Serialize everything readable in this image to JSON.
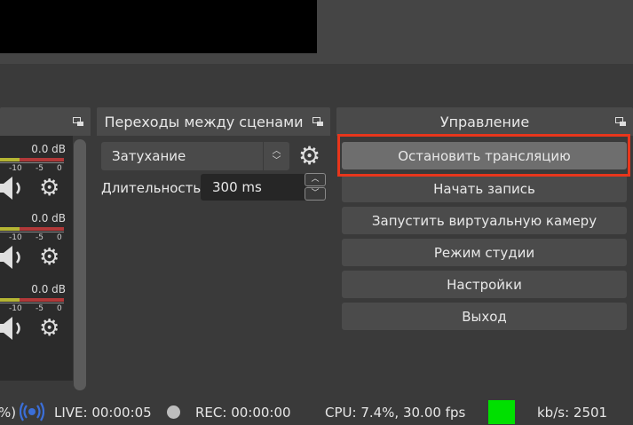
{
  "mixer": {
    "channels": [
      {
        "db": "0.0 dB",
        "scale": [
          "-10",
          "-5",
          "0"
        ]
      },
      {
        "db": "0.0 dB",
        "scale": [
          "-10",
          "-5",
          "0"
        ]
      },
      {
        "db": "0.0 dB",
        "scale": [
          "-10",
          "-5",
          "0"
        ]
      }
    ]
  },
  "transitions": {
    "title": "Переходы между сценами",
    "selected": "Затухание",
    "duration_label": "Длительность",
    "duration_value": "300 ms"
  },
  "controls": {
    "title": "Управление",
    "buttons": [
      "Остановить трансляцию",
      "Начать запись",
      "Запустить виртуальную камеру",
      "Режим студии",
      "Настройки",
      "Выход"
    ]
  },
  "statusbar": {
    "dropped_frames_fragment": "%)",
    "live": "LIVE: 00:00:05",
    "rec": "REC: 00:00:00",
    "cpu": "CPU: 7.4%, 30.00 fps",
    "kbs": "kb/s: 2501"
  },
  "colors": {
    "accent_highlight": "#e8361c",
    "stream_health": "#00e000",
    "live_icon": "#3b6fd9"
  }
}
